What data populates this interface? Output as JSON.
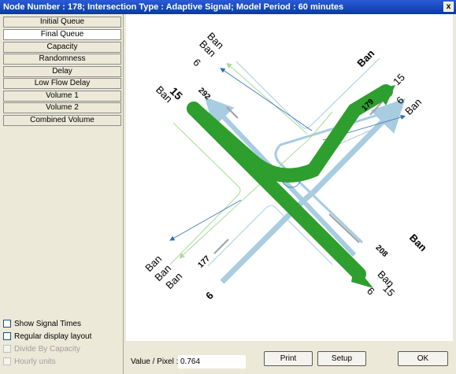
{
  "window": {
    "title": "Node Number : 178; Intersection Type : Adaptive Signal; Model Period : 60 minutes",
    "close_label": "x"
  },
  "tabs": [
    {
      "label": "Initial Queue",
      "active": false
    },
    {
      "label": "Final Queue",
      "active": true
    },
    {
      "label": "Capacity",
      "active": false
    },
    {
      "label": "Randomness",
      "active": false
    },
    {
      "label": "Delay",
      "active": false
    },
    {
      "label": "Low Flow Delay",
      "active": false
    },
    {
      "label": "Volume 1",
      "active": false
    },
    {
      "label": "Volume 2",
      "active": false
    },
    {
      "label": "Combined Volume",
      "active": false
    }
  ],
  "options": [
    {
      "label": "Show Signal Times",
      "checked": false,
      "enabled": true
    },
    {
      "label": "Regular display layout",
      "checked": false,
      "enabled": true
    },
    {
      "label": "Divide By Capacity",
      "checked": false,
      "enabled": false
    },
    {
      "label": "Hourly units",
      "checked": false,
      "enabled": false
    }
  ],
  "diagram": {
    "labels": {
      "nw_road_big": "15",
      "nw_road_ban": "Ban",
      "nw_top_ban1": "Ban",
      "nw_top_ban2": "Ban",
      "nw_top_num": "6",
      "ne_ban": "Ban",
      "ne_num15": "15",
      "ne_num6": "6",
      "ne_ban2": "Ban",
      "se_ban": "Ban",
      "se_ban2": "Ban",
      "se_num15": "15",
      "se_num6": "6",
      "sw_ban1": "Ban",
      "sw_ban2": "Ban",
      "sw_ban3": "Ban",
      "sw_num6": "6",
      "val_292": "292",
      "val_179": "179",
      "val_177": "177",
      "val_208": "208"
    },
    "colors": {
      "major_flow": "#2e9e2e",
      "light_blue": "#a8cce0",
      "dark_blue": "#3070b0",
      "light_green": "#a8dc98",
      "queue_bar": "#a0a0a0"
    }
  },
  "footer": {
    "value_label": "Value / Pixel :",
    "value": "0.764",
    "print_label": "Print",
    "setup_label": "Setup",
    "ok_label": "OK"
  }
}
